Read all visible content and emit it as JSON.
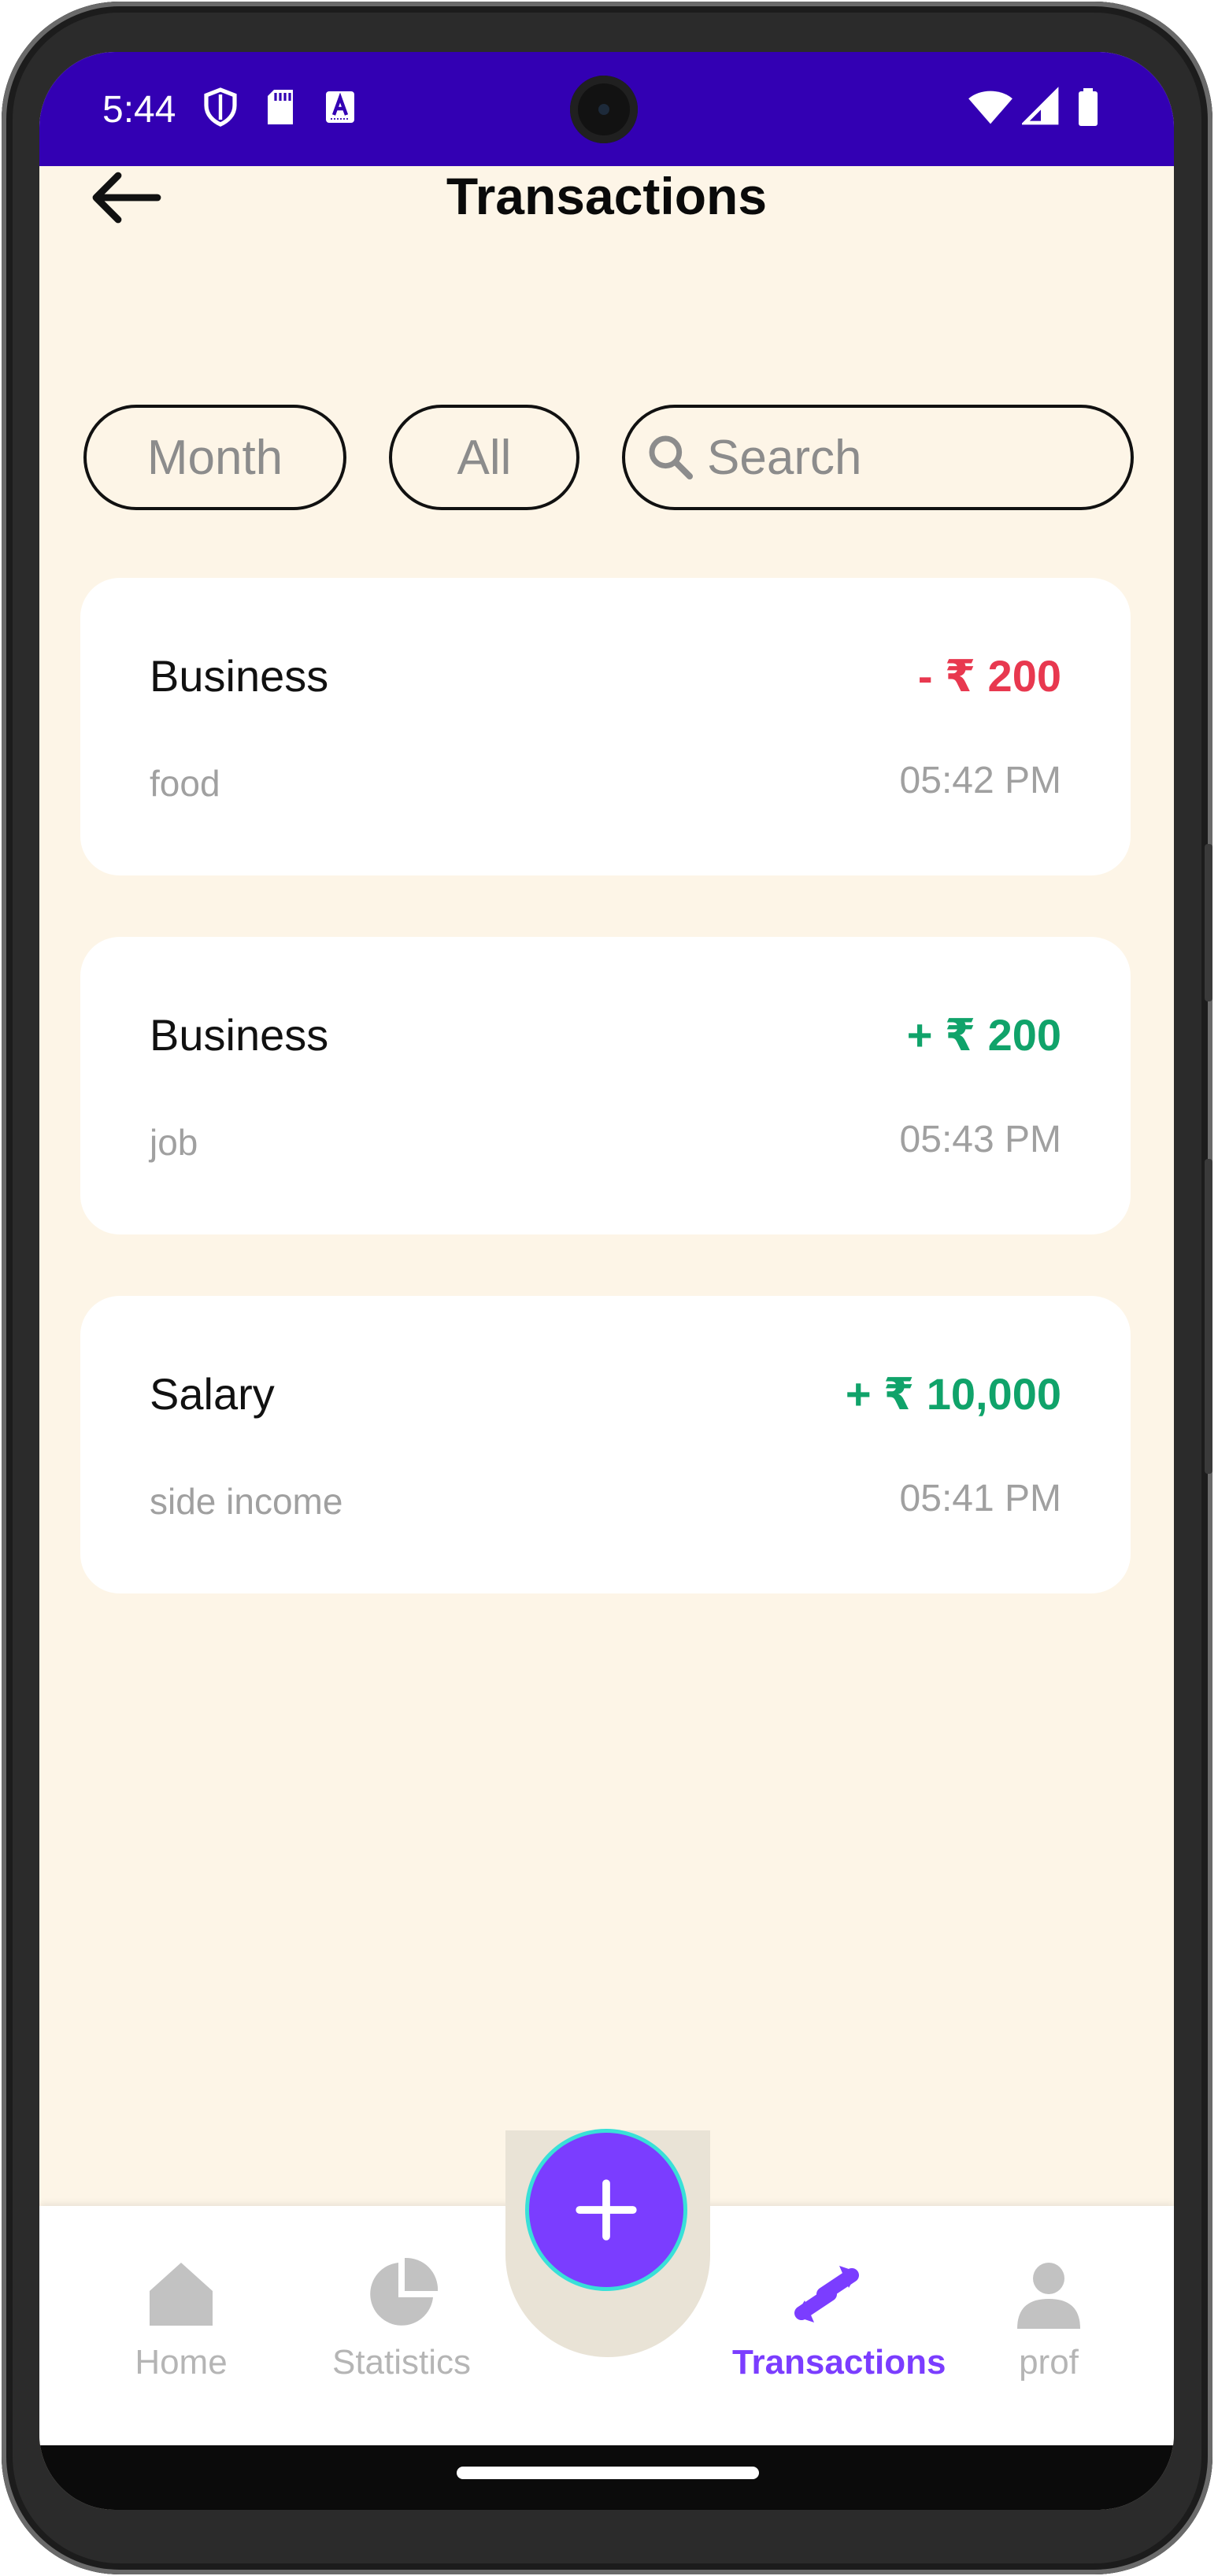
{
  "status_bar": {
    "time": "5:44",
    "left_icons": [
      "shield-icon",
      "sd-card-icon",
      "text-a-icon"
    ],
    "right_icons": [
      "wifi-icon",
      "cell-signal-icon",
      "battery-icon"
    ],
    "color": "#3300b3"
  },
  "header": {
    "title": "Transactions",
    "back_icon": "arrow-left-icon"
  },
  "filters": {
    "month_label": "Month",
    "type_label": "All",
    "search_placeholder": "Search"
  },
  "transactions": [
    {
      "category": "Business",
      "amount": "- ₹ 200",
      "note": "food",
      "time": "05:42 PM",
      "type": "expense"
    },
    {
      "category": "Business",
      "amount": "+ ₹ 200",
      "note": "job",
      "time": "05:43 PM",
      "type": "income"
    },
    {
      "category": "Salary",
      "amount": "+ ₹ 10,000",
      "note": "side income",
      "time": "05:41 PM",
      "type": "income"
    }
  ],
  "nav": {
    "items": [
      {
        "label": "Home",
        "icon": "home-icon",
        "active": false
      },
      {
        "label": "Statistics",
        "icon": "pie-chart-icon",
        "active": false
      },
      {
        "label": "Transactions",
        "icon": "transfer-icon",
        "active": true
      },
      {
        "label": "prof",
        "icon": "person-icon",
        "active": false
      }
    ],
    "fab_icon": "plus-icon"
  },
  "colors": {
    "background": "#fdf5e7",
    "expense": "#e8384f",
    "income": "#10a36a",
    "accent": "#7b3dff",
    "inactive": "#c2c2c2"
  }
}
